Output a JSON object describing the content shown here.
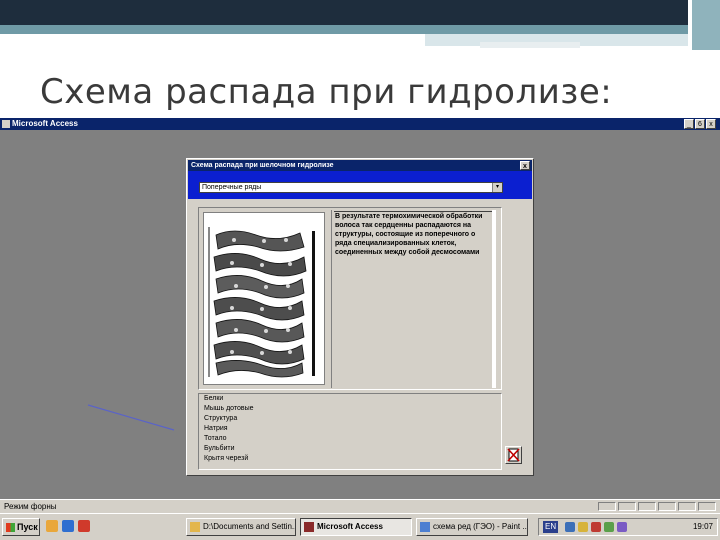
{
  "slide": {
    "title": "Схема распада при гидролизе:"
  },
  "app": {
    "title": "Microsoft Access",
    "controls": [
      "_",
      "6",
      "x"
    ]
  },
  "dialog": {
    "title": "Схема распада при шелочном гидролизе",
    "close": "x",
    "combo_value": "Поперечные ряды",
    "combo_button": "▾",
    "description": "В результате термохимической обработки волоса так сердценны распадаются на структуры, состоящие из поперечного о ряда специализированных клеток, соединенных между собой десмосомами",
    "list_items": [
      "Белки",
      "Мышь дотовые",
      "Структура",
      "Натрия",
      "Тотало",
      "Бульбити",
      "Крытя черезй"
    ]
  },
  "statusbar": {
    "text": "Режим форны"
  },
  "taskbar": {
    "start": "Пуск",
    "buttons": [
      "D:\\Documents and Settin...",
      "Microsoft Access",
      "схема ред (ГЭО) - Paint ..."
    ],
    "lang": "EN",
    "clock": "19:07"
  },
  "colors": {
    "title_bar": "#0a246a",
    "dialog_header_panel": "#0b1fd0",
    "workspace": "#808080",
    "chrome": "#d4d0c8",
    "annotation_line": "#5a63c7"
  }
}
